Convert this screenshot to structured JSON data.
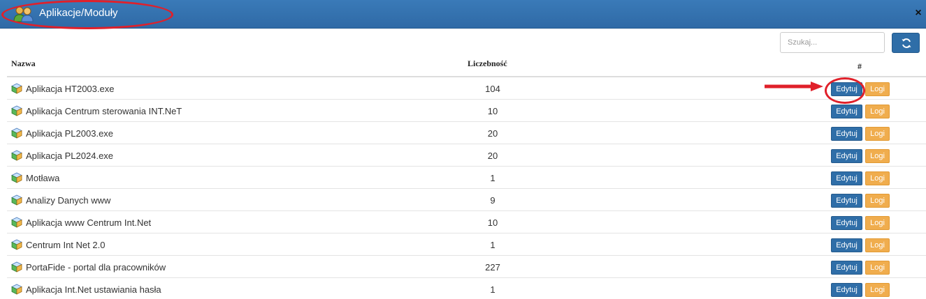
{
  "window": {
    "title": "Aplikacje/Moduły",
    "icon": "users-icon",
    "close_label": "×"
  },
  "toolbar": {
    "search_placeholder": "Szukaj...",
    "refresh_icon": "refresh-icon"
  },
  "table": {
    "headers": {
      "name": "Nazwa",
      "count": "Liczebność",
      "actions": "#"
    },
    "rows": [
      {
        "name": "Aplikacja HT2003.exe",
        "count": "104",
        "edit": "Edytuj",
        "logs": "Logi"
      },
      {
        "name": "Aplikacja Centrum sterowania INT.NeT",
        "count": "10",
        "edit": "Edytuj",
        "logs": "Logi"
      },
      {
        "name": "Aplikacja PL2003.exe",
        "count": "20",
        "edit": "Edytuj",
        "logs": "Logi"
      },
      {
        "name": "Aplikacja PL2024.exe",
        "count": "20",
        "edit": "Edytuj",
        "logs": "Logi"
      },
      {
        "name": "Motława",
        "count": "1",
        "edit": "Edytuj",
        "logs": "Logi"
      },
      {
        "name": "Analizy Danych www",
        "count": "9",
        "edit": "Edytuj",
        "logs": "Logi"
      },
      {
        "name": "Aplikacja www Centrum Int.Net",
        "count": "10",
        "edit": "Edytuj",
        "logs": "Logi"
      },
      {
        "name": "Centrum Int Net 2.0",
        "count": "1",
        "edit": "Edytuj",
        "logs": "Logi"
      },
      {
        "name": "PortaFide - portal dla pracowników",
        "count": "227",
        "edit": "Edytuj",
        "logs": "Logi"
      },
      {
        "name": "Aplikacja Int.Net ustawiania hasła",
        "count": "1",
        "edit": "Edytuj",
        "logs": "Logi"
      }
    ]
  },
  "colors": {
    "titlebar": "#2f6aa6",
    "primary_button": "#2f6ea8",
    "warning_button": "#f0ad4e",
    "annotation": "#e0202a"
  }
}
